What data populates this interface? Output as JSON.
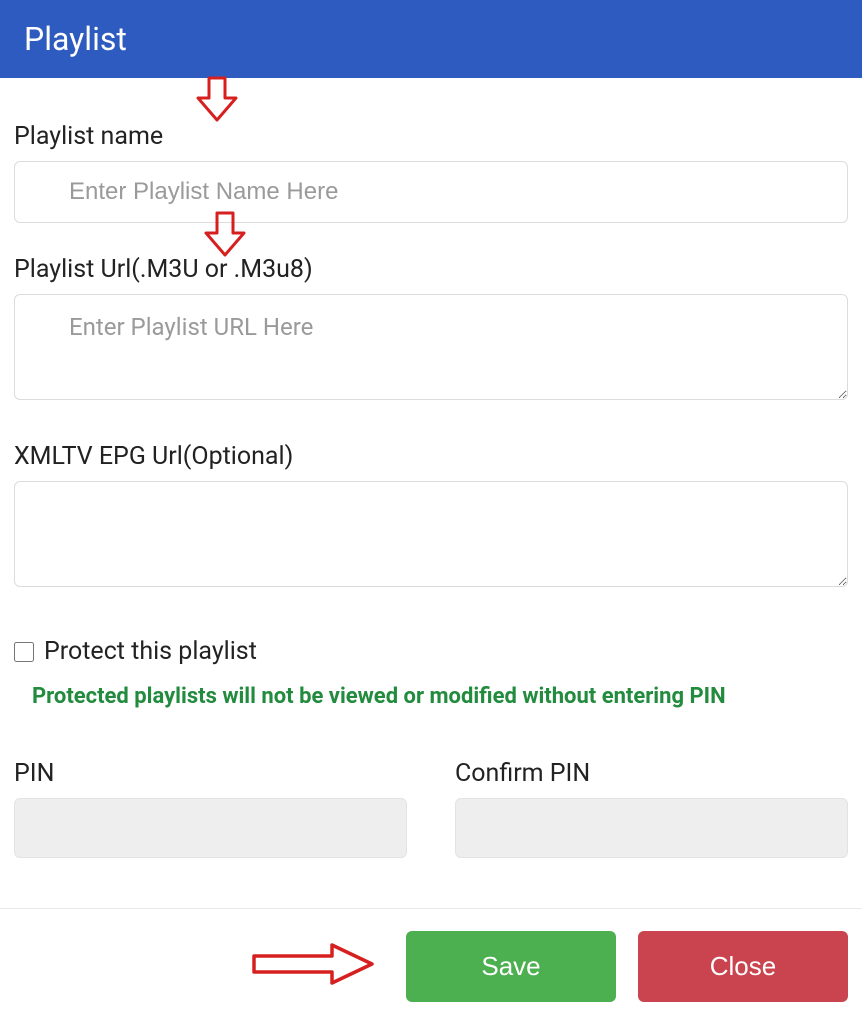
{
  "header": {
    "title": "Playlist"
  },
  "fields": {
    "playlist_name": {
      "label": "Playlist name",
      "placeholder": "Enter Playlist Name Here",
      "value": ""
    },
    "playlist_url": {
      "label": "Playlist Url(.M3U or .M3u8)",
      "placeholder": "Enter Playlist URL Here",
      "value": ""
    },
    "epg_url": {
      "label": "XMLTV EPG Url(Optional)",
      "value": ""
    },
    "protect": {
      "label": "Protect this playlist",
      "hint": "Protected playlists will not be viewed or modified without entering PIN",
      "checked": false
    },
    "pin": {
      "label": "PIN",
      "value": ""
    },
    "confirm_pin": {
      "label": "Confirm PIN",
      "value": ""
    }
  },
  "buttons": {
    "save": "Save",
    "close": "Close"
  }
}
